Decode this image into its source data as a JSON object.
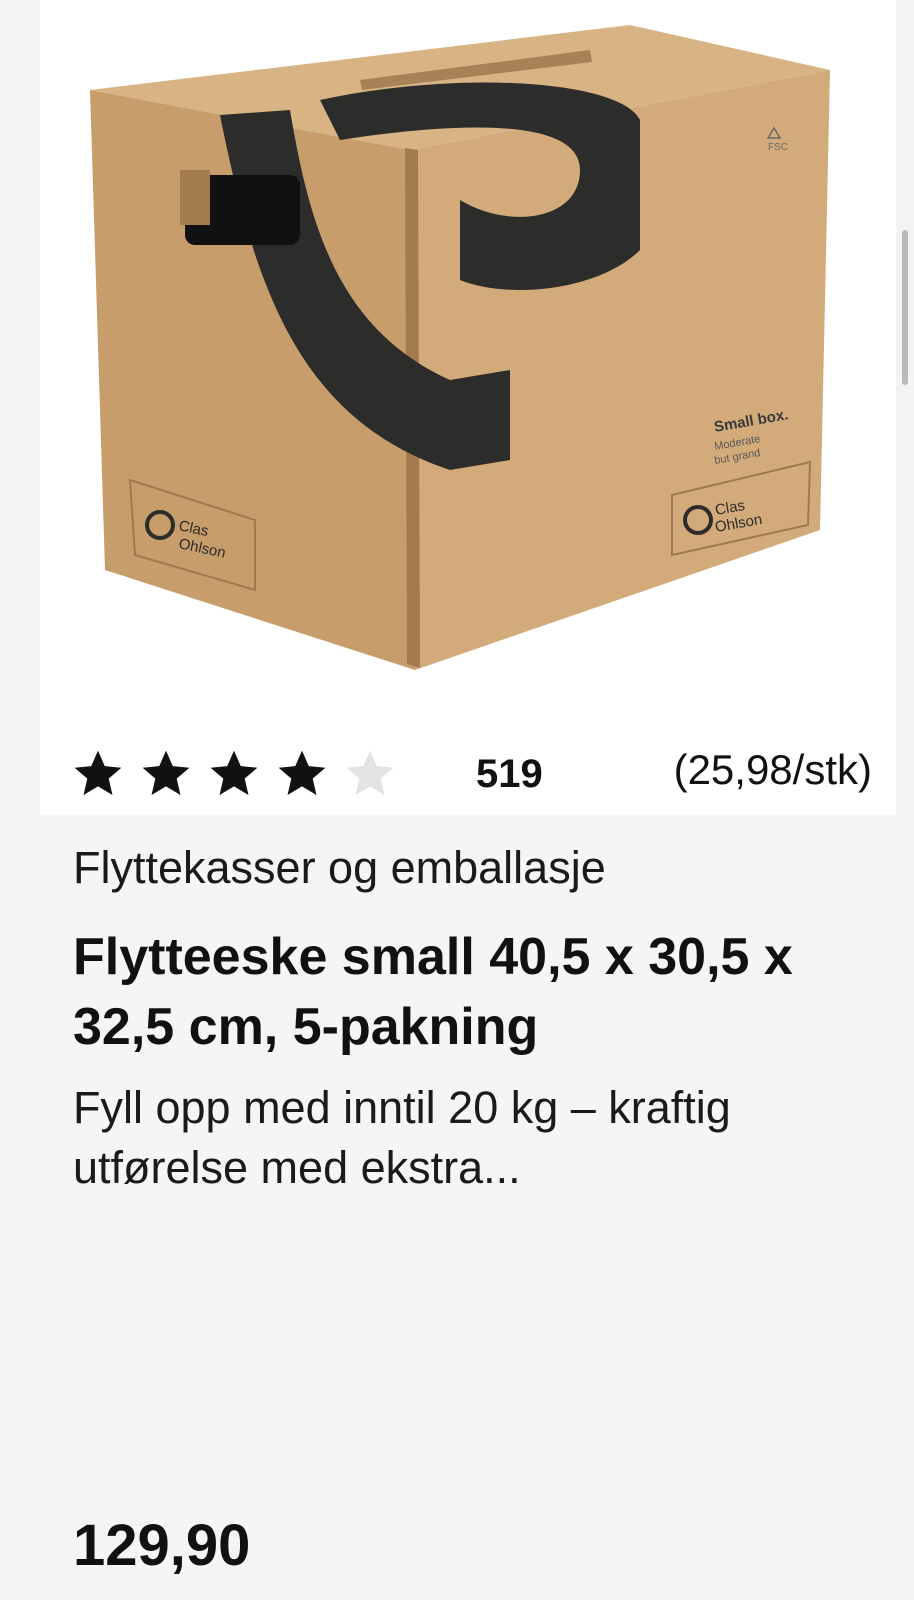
{
  "product": {
    "image_alt": "Cardboard moving box with Clas Ohlson logo",
    "image_texts": {
      "brand_logo": "Clas Ohlson",
      "side_label_title": "Small box.",
      "side_label_sub": "Moderate but grand",
      "fsc": "FSC"
    },
    "rating": {
      "stars_filled": 4,
      "stars_total": 5,
      "review_count": "519"
    },
    "unit_price": "(25,98/stk)",
    "category": "Flyttekasser og emballasje",
    "title": "Flytteeske small 40,5 x 30,5 x 32,5 cm, 5-pakning",
    "description": "Fyll opp med inntil 20 kg – kraftig utførelse med ekstra...",
    "price": "129,90"
  },
  "colors": {
    "star_filled": "#111111",
    "star_empty": "#e3e3e3",
    "cardboard": "#c9a171",
    "logo_dark": "#2c2c2a"
  }
}
